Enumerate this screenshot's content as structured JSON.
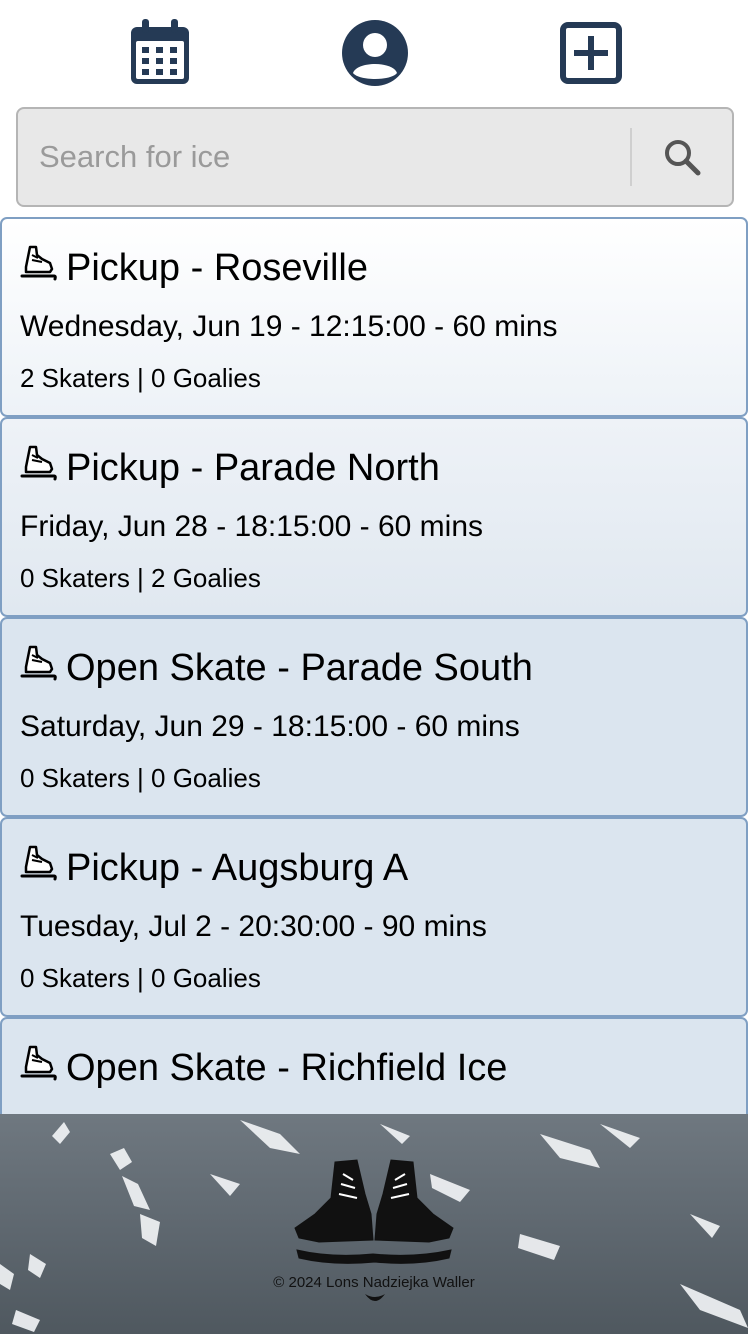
{
  "nav": {
    "items": [
      {
        "icon": "calendar-icon"
      },
      {
        "icon": "profile-icon"
      },
      {
        "icon": "add-square-icon"
      }
    ]
  },
  "search": {
    "placeholder": "Search for ice",
    "value": "",
    "icon": "search-icon"
  },
  "colors": {
    "navy": "#253a55",
    "card_border": "#7f9fc3",
    "card_bg_top": "#ffffff",
    "card_bg_bottom": "#dbe5ef"
  },
  "sessions": [
    {
      "icon": "ice-skate-icon",
      "title": "Pickup - Roseville",
      "when": "Wednesday, Jun 19 - 12:15:00 - 60 mins",
      "counts": "2 Skaters | 0 Goalies"
    },
    {
      "icon": "ice-skate-icon",
      "title": "Pickup - Parade North",
      "when": "Friday, Jun 28 - 18:15:00 - 60 mins",
      "counts": "0 Skaters | 2 Goalies"
    },
    {
      "icon": "ice-skate-icon",
      "title": "Open Skate - Parade South",
      "when": "Saturday, Jun 29 - 18:15:00 - 60 mins",
      "counts": "0 Skaters | 0 Goalies"
    },
    {
      "icon": "ice-skate-icon",
      "title": "Pickup - Augsburg A",
      "when": "Tuesday, Jul 2 - 20:30:00 - 90 mins",
      "counts": "0 Skaters | 0 Goalies"
    },
    {
      "icon": "ice-skate-icon",
      "title": "Open Skate - Richfield Ice",
      "when": "",
      "counts": ""
    }
  ],
  "footer": {
    "copyright": "© 2024 Lons Nadziejka Waller",
    "logo": "hockey-skates-logo"
  }
}
